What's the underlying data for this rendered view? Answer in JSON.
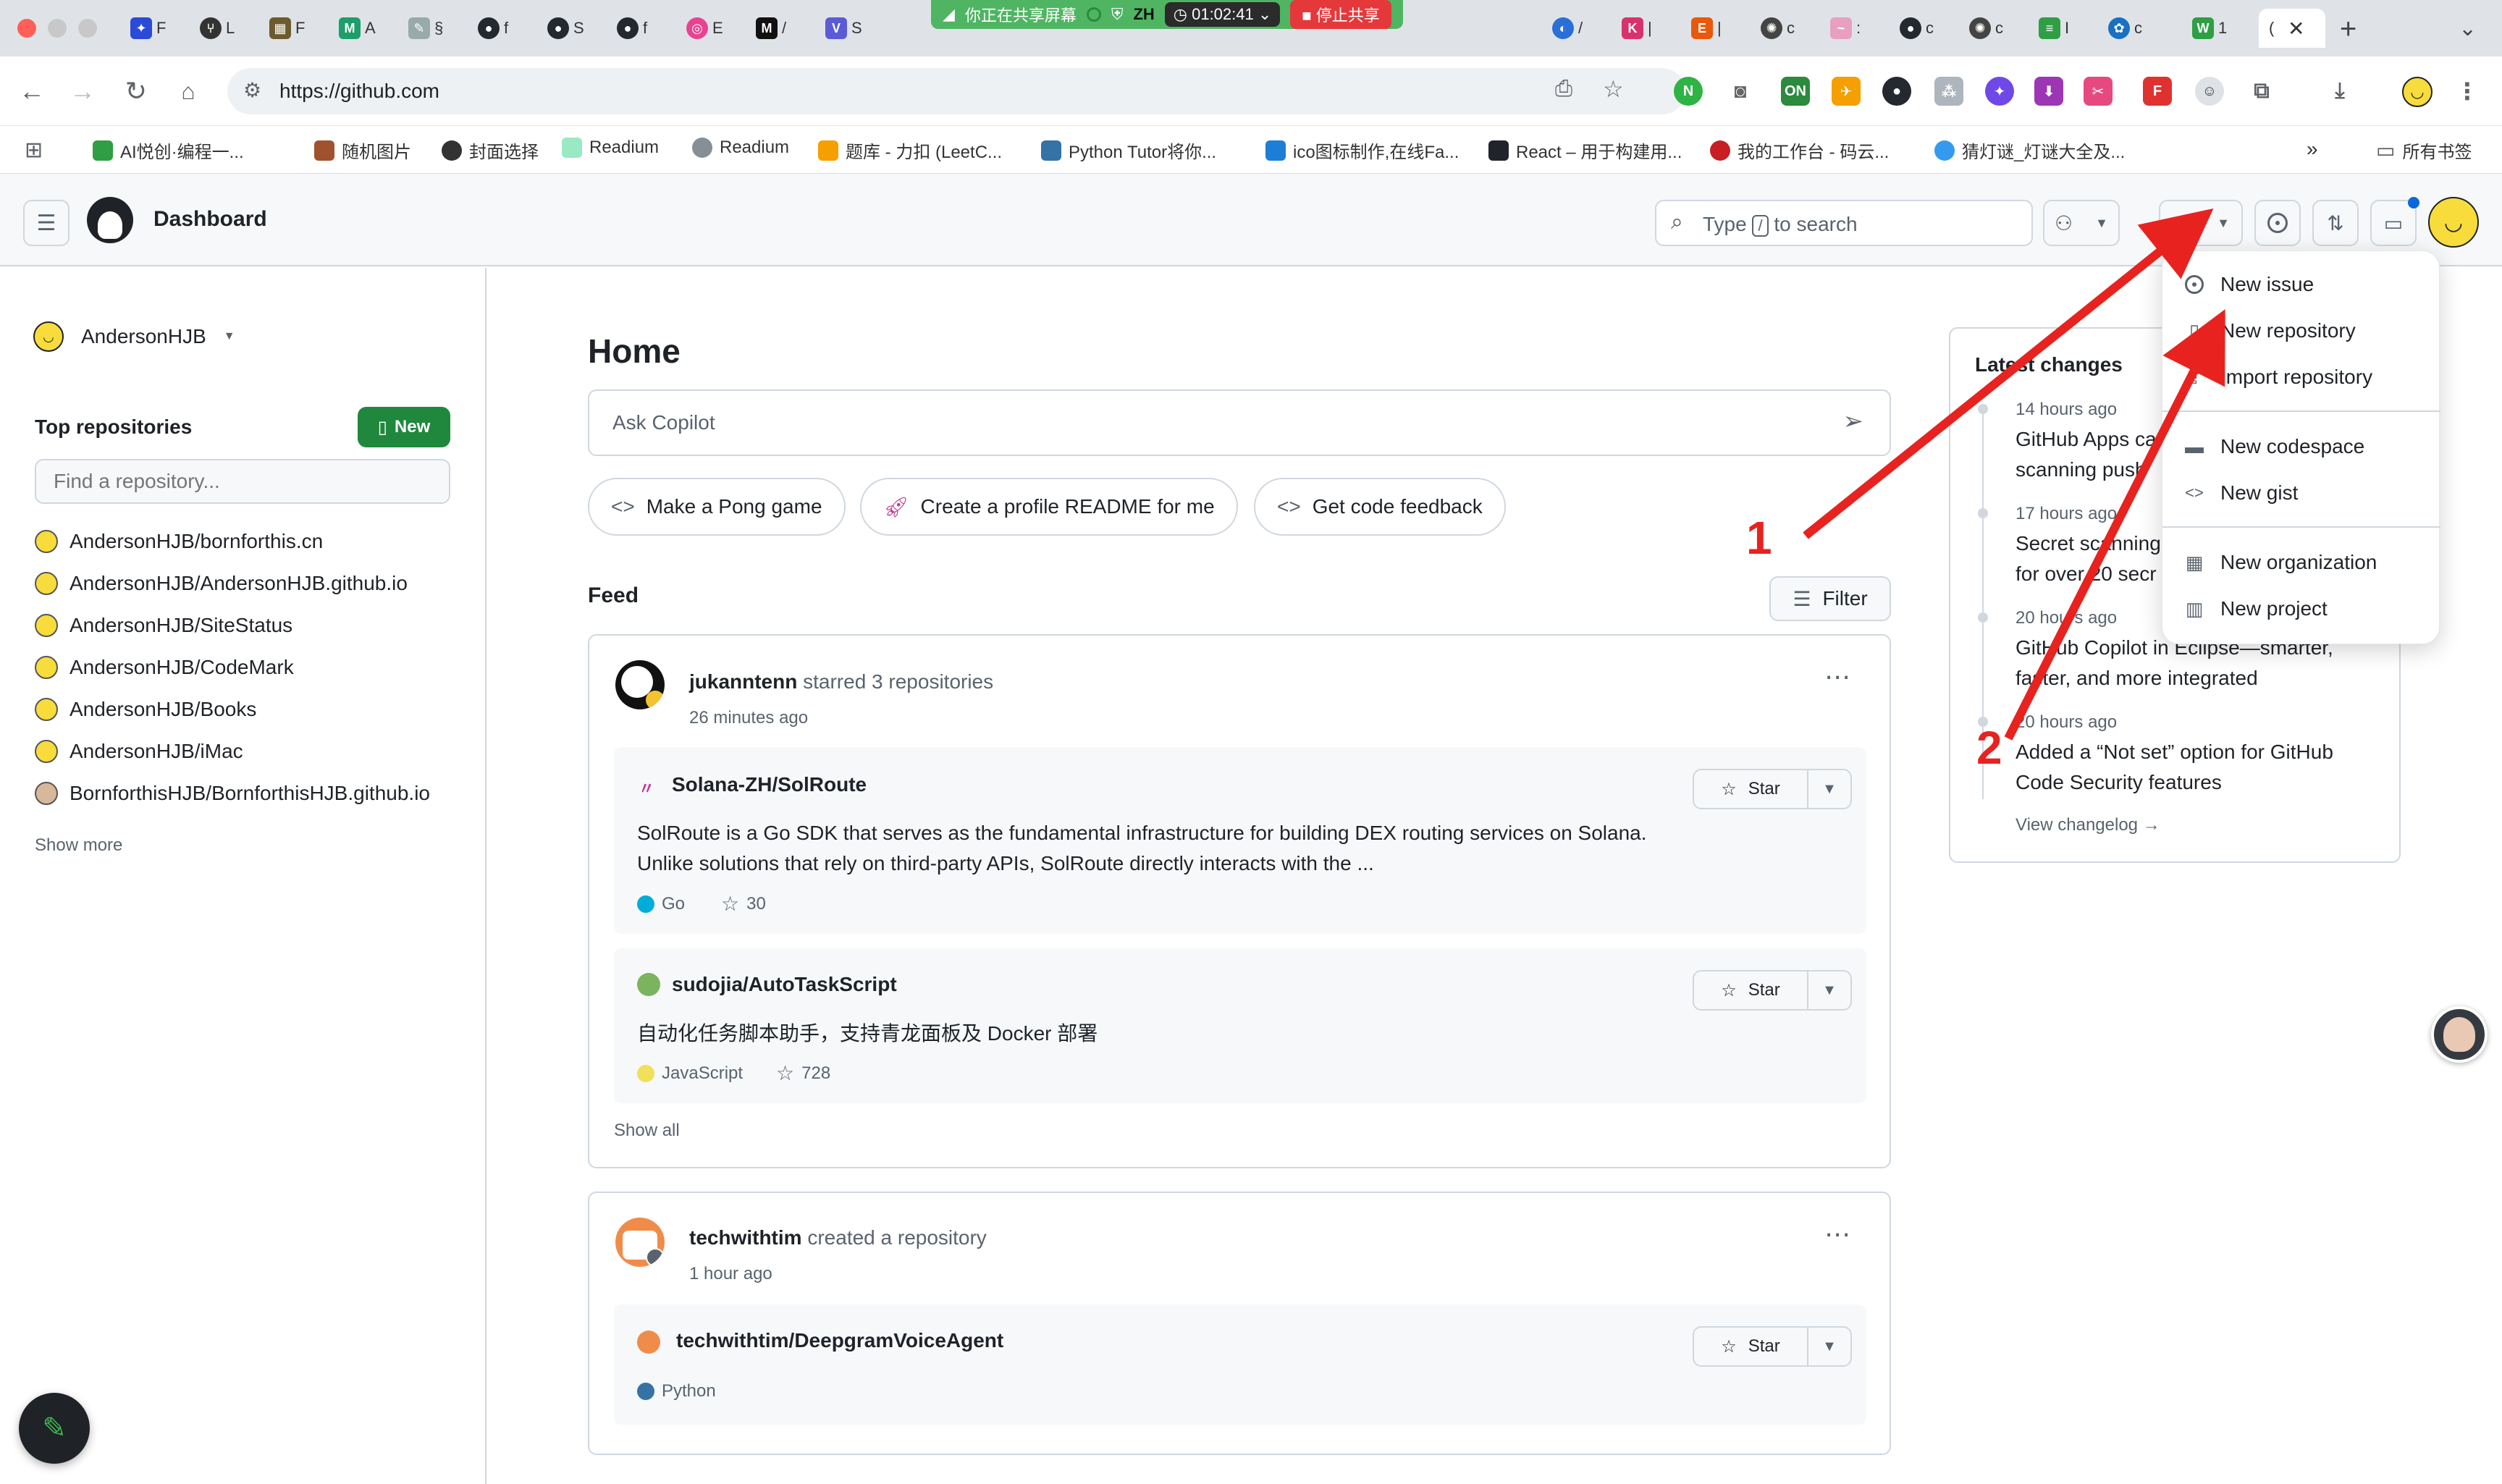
{
  "screen_share": {
    "label": "你正在共享屏幕",
    "lang": "ZH",
    "timer": "01:02:41",
    "stop_label": "停止共享"
  },
  "browser": {
    "url": "https://github.com",
    "bookmarks": [
      "AI悦创·编程一...",
      "随机图片",
      "封面选择",
      "Readium",
      "Readium",
      "题库 - 力扣 (LeetC...",
      "Python Tutor将你...",
      "ico图标制作,在线Fa...",
      "React – 用于构建用...",
      "我的工作台 - 码云...",
      "猜灯谜_灯谜大全及...",
      "所有书签"
    ]
  },
  "header": {
    "title": "Dashboard",
    "search_prefix": "Type",
    "search_key": "/",
    "search_suffix": "to search"
  },
  "dropdown": {
    "items": [
      "New issue",
      "New repository",
      "Import repository",
      "New codespace",
      "New gist",
      "New organization",
      "New project"
    ]
  },
  "sidebar": {
    "username": "AndersonHJB",
    "section_title": "Top repositories",
    "new_button": "New",
    "find_placeholder": "Find a repository...",
    "repos": [
      "AndersonHJB/bornforthis.cn",
      "AndersonHJB/AndersonHJB.github.io",
      "AndersonHJB/SiteStatus",
      "AndersonHJB/CodeMark",
      "AndersonHJB/Books",
      "AndersonHJB/iMac",
      "BornforthisHJB/BornforthisHJB.github.io"
    ],
    "show_more": "Show more"
  },
  "main": {
    "home_title": "Home",
    "copilot_placeholder": "Ask Copilot",
    "suggestions": [
      "Make a Pong game",
      "Create a profile README for me",
      "Get code feedback"
    ],
    "feed_title": "Feed",
    "filter_label": "Filter",
    "feed": [
      {
        "user": "jukanntenn",
        "action": "starred 3 repositories",
        "time": "26 minutes ago",
        "repos": [
          {
            "name": "Solana-ZH/SolRoute",
            "desc_line1": "SolRoute is a Go SDK that serves as the fundamental infrastructure for building DEX routing services on Solana.",
            "desc_line2": "Unlike solutions that rely on third-party APIs, SolRoute directly interacts with the ...",
            "lang": "Go",
            "lang_color": "#00add8",
            "stars": "30"
          },
          {
            "name": "sudojia/AutoTaskScript",
            "desc_line1": "自动化任务脚本助手，支持青龙面板及 Docker 部署",
            "lang": "JavaScript",
            "lang_color": "#f1e05a",
            "stars": "728"
          }
        ],
        "show_all": "Show all"
      },
      {
        "user": "techwithtim",
        "action": "created a repository",
        "time": "1 hour ago",
        "repo": {
          "name": "techwithtim/DeepgramVoiceAgent",
          "lang": "Python",
          "lang_color": "#3572a5"
        }
      }
    ],
    "star_label": "Star"
  },
  "changelog": {
    "title": "Latest changes",
    "entries": [
      {
        "time": "14 hours ago",
        "line1": "GitHub Apps ca",
        "line2": "scanning push"
      },
      {
        "time": "17 hours ago",
        "line1": "Secret scanning",
        "line2": "for over 20 secr"
      },
      {
        "time": "20 hours ago",
        "line1": "GitHub Copilot in Eclipse—smarter,",
        "line2": "faster, and more integrated"
      },
      {
        "time": "20 hours ago",
        "line1": "Added a “Not set” option for GitHub",
        "line2": "Code Security features"
      }
    ],
    "view_link": "View changelog →"
  },
  "annotations": {
    "step1": "1",
    "step2": "2",
    "arrow_color": "#e8221f"
  },
  "colors": {
    "green": "#1f883d",
    "border": "#d0d7de",
    "muted": "#59636e"
  }
}
